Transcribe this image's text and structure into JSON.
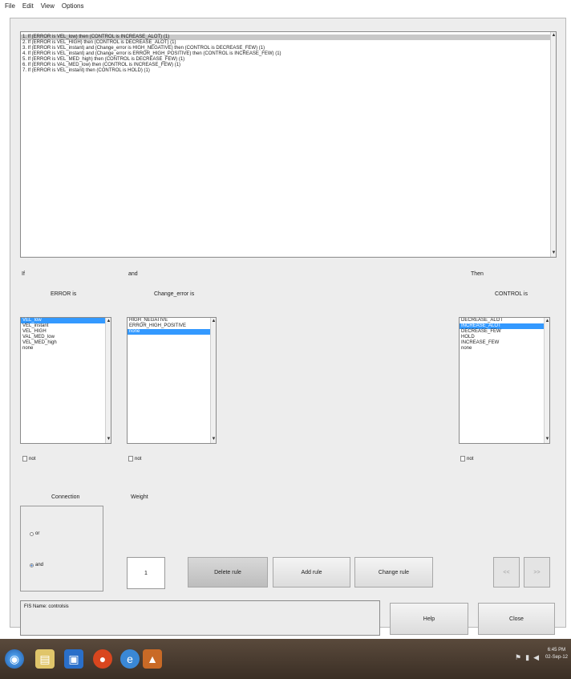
{
  "menu": [
    "File",
    "Edit",
    "View",
    "Options"
  ],
  "rules": [
    "1. If (ERROR is VEL_low) then (CONTROL is INCREASE_ALOT) (1)",
    "2. If (ERROR is VEL_HIGH) then (CONTROL is DECREASE_ALOT) (1)",
    "3. If (ERROR is VEL_instant) and (Change_error is HIGH_NEGATIVE) then (CONTROL is DECREASE_FEW) (1)",
    "4. If (ERROR is VEL_instant) and (Change_error is ERROR_HIGH_POSITIVE) then (CONTROL is INCREASE_FEW) (1)",
    "5. If (ERROR is VEL_MED_high) then (CONTROL is DECREASE_FEW) (1)",
    "6. If (ERROR is VAL_MED_low) then (CONTROL is INCREASE_FEW) (1)",
    "7. If (ERROR is VEL_instant) then (CONTROL is HOLD) (1)"
  ],
  "labels": {
    "if": "If",
    "and": "and",
    "then": "Then",
    "error_is": "ERROR is",
    "change_error_is": "Change_error is",
    "control_is": "CONTROL is",
    "connection": "Connection",
    "weight": "Weight"
  },
  "error_options": [
    "VEL_low",
    "VEL_instant",
    "VEL_HIGH",
    "VAL_MED_low",
    "VEL_MED_high",
    "none"
  ],
  "change_error_options": [
    "HIGH_NEGATIVE",
    "ERROR_HIGH_POSITIVE",
    "none"
  ],
  "control_options": [
    "DECREASE_ALOT",
    "INCREASE_ALOT",
    "DECREASE_FEW",
    "HOLD",
    "INCREASE_FEW",
    "none"
  ],
  "not_label": "not",
  "radios": {
    "or": "or",
    "and": "and"
  },
  "weight_value": "1",
  "buttons": {
    "delete": "Delete rule",
    "add": "Add rule",
    "change": "Change rule",
    "prev": "<<",
    "next": ">>",
    "help": "Help",
    "close": "Close"
  },
  "status": "FIS Name: controlsis",
  "clock": {
    "time": "6:45 PM",
    "date": "02-Sep-12"
  }
}
